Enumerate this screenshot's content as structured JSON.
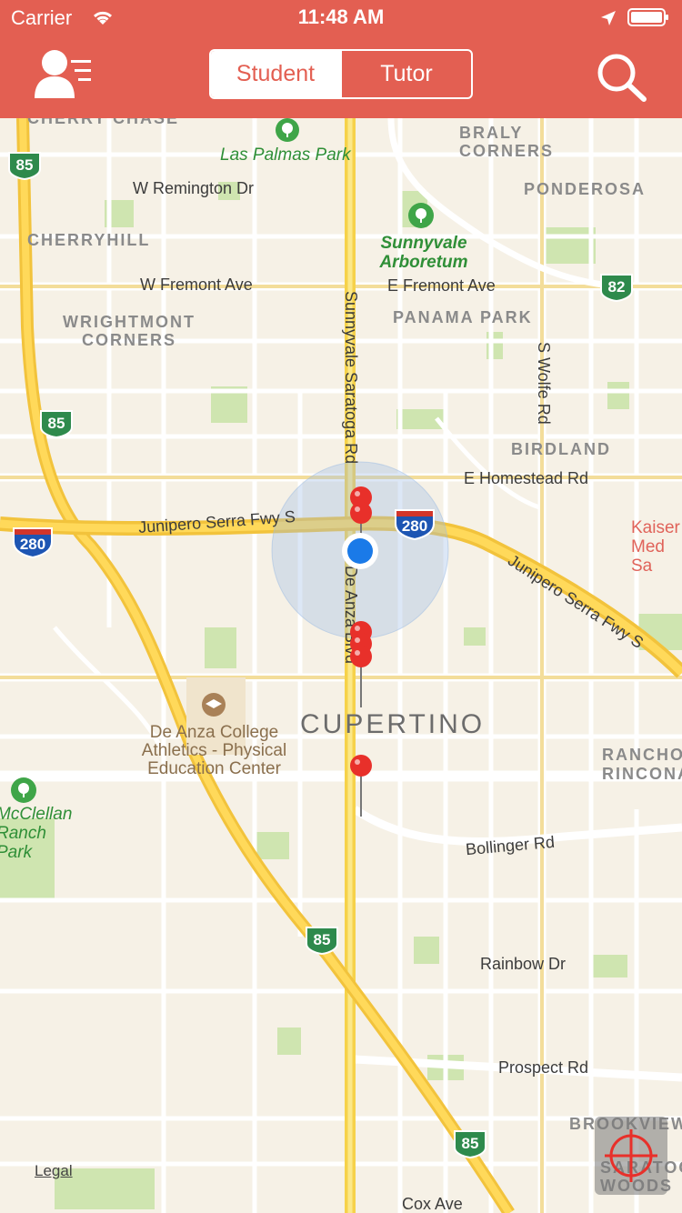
{
  "status_bar": {
    "carrier": "Carrier",
    "time": "11:48 AM",
    "icons": [
      "wifi-icon",
      "location-arrow-icon",
      "battery-icon"
    ]
  },
  "header": {
    "background_color": "#e35f52",
    "profile_menu_icon": "person-list-icon",
    "segments": [
      {
        "label": "Student",
        "selected": true
      },
      {
        "label": "Tutor",
        "selected": false
      }
    ],
    "search_icon": "search-icon"
  },
  "map": {
    "area_labels": [
      "CHERRY CHASE",
      "BRALY CORNERS",
      "PONDEROSA",
      "CHERRYHILL",
      "WRIGHTMONT CORNERS",
      "PANAMA PARK",
      "BIRDLAND",
      "RANCHO RINCONADA",
      "BROOKVIEW",
      "SARATOGA WOODS"
    ],
    "street_labels": [
      "W Remington Dr",
      "W Fremont Ave",
      "E Fremont Ave",
      "Sunnyvale Saratoga Rd",
      "S Wolfe Rd",
      "E Homestead Rd",
      "Junipero Serra Fwy S",
      "Junipero Serra Fwy S",
      "S De Anza Blvd",
      "Bollinger Rd",
      "Rainbow Dr",
      "Prospect Rd",
      "Cox Ave"
    ],
    "park_labels": [
      "Las Palmas Park",
      "Sunnyvale Arboretum",
      "McClellan Ranch Park"
    ],
    "poi_label": "De Anza College Athletics - Physical Education Center",
    "city_label": "CUPERTINO",
    "hospital_label": "Kaiser Med Sa",
    "highway_shields": [
      {
        "route": "85",
        "type": "state"
      },
      {
        "route": "85",
        "type": "state"
      },
      {
        "route": "82",
        "type": "state"
      },
      {
        "route": "280",
        "type": "interstate"
      },
      {
        "route": "280",
        "type": "interstate"
      },
      {
        "route": "85",
        "type": "state"
      },
      {
        "route": "85",
        "type": "state"
      }
    ],
    "pins": {
      "count": 7,
      "color": "#e8302a"
    },
    "user_location_color": "#1a7ae8",
    "legal_link": "Legal",
    "locate_button_icon": "crosshair-icon"
  }
}
